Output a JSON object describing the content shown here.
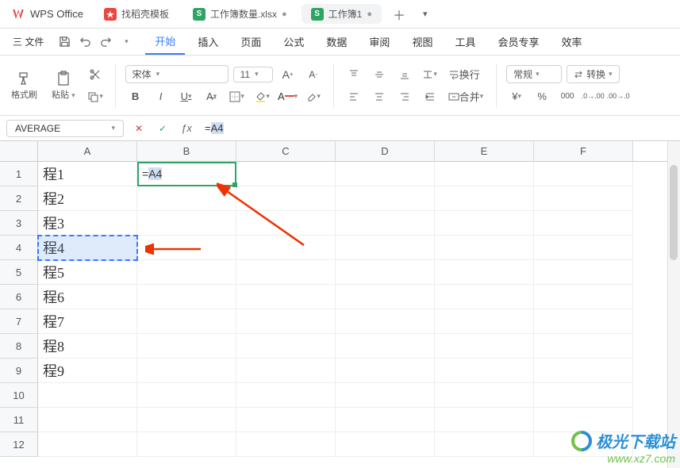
{
  "app": {
    "name": "WPS Office"
  },
  "tabs": [
    {
      "label": "找稻壳模板",
      "icon_bg": "red",
      "icon_letter": ""
    },
    {
      "label": "工作簿数量.xlsx",
      "icon_bg": "green",
      "icon_letter": "S"
    },
    {
      "label": "工作簿1",
      "icon_bg": "green",
      "icon_letter": "S"
    }
  ],
  "menubar": {
    "file": "三 文件",
    "items": [
      "开始",
      "插入",
      "页面",
      "公式",
      "数据",
      "审阅",
      "视图",
      "工具",
      "会员专享",
      "效率"
    ],
    "active_index": 0
  },
  "ribbon": {
    "format_painter": "格式刷",
    "paste": "粘贴",
    "font_name": "宋体",
    "font_size": "11",
    "bold": "B",
    "italic": "I",
    "underline": "U",
    "wrap": "换行",
    "merge": "合并",
    "number_format": "常规",
    "convert": "转换",
    "currency": "¥",
    "percent": "%"
  },
  "formula_bar": {
    "name_box": "AVERAGE",
    "formula_prefix": "=",
    "formula_ref": "A4"
  },
  "columns": [
    "A",
    "B",
    "C",
    "D",
    "E",
    "F"
  ],
  "rows": [
    1,
    2,
    3,
    4,
    5,
    6,
    7,
    8,
    9,
    10,
    11,
    12
  ],
  "cells": {
    "A1": "程1",
    "A2": "程2",
    "A3": "程3",
    "A4": "程4",
    "A5": "程5",
    "A6": "程6",
    "A7": "程7",
    "A8": "程8",
    "A9": "程9",
    "B1_prefix": "=",
    "B1_ref": "A4"
  },
  "watermark": {
    "line1": "极光下载站",
    "line2": "www.xz7.com"
  },
  "chart_data": null
}
